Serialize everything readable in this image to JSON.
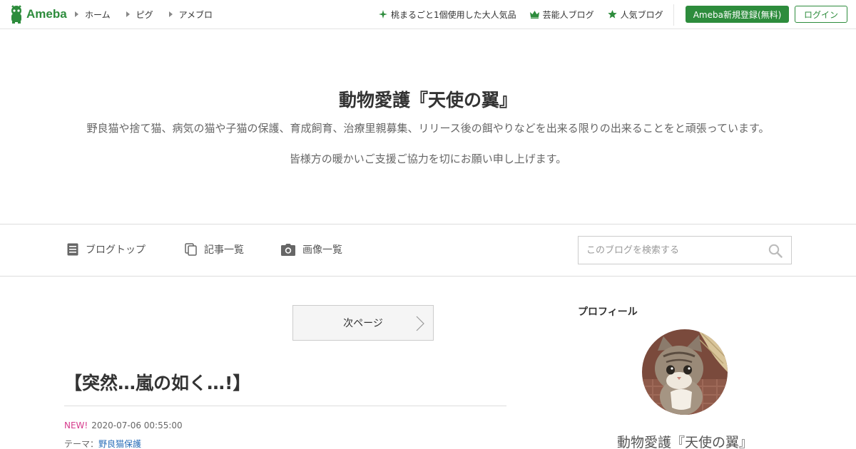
{
  "header": {
    "logo_text": "Ameba",
    "nav_left": [
      "ホーム",
      "ピグ",
      "アメブロ"
    ],
    "nav_right": [
      {
        "label": "桃まるごと1個使用した大人気品",
        "icon": "sparkle-icon"
      },
      {
        "label": "芸能人ブログ",
        "icon": "crown-icon"
      },
      {
        "label": "人気ブログ",
        "icon": "star-icon"
      }
    ],
    "register_label": "Ameba新規登録(無料)",
    "login_label": "ログイン"
  },
  "blog": {
    "title": "動物愛護『天使の翼』",
    "description": "野良猫や捨て猫、病気の猫や子猫の保護、育成飼育、治療里親募集、リリース後の餌やりなどを出来る限りの出来ることをと頑張っています。",
    "description2": "皆様方の暖かいご支援ご協力を切にお願い申し上げます。"
  },
  "subnav": {
    "items": [
      "ブログトップ",
      "記事一覧",
      "画像一覧"
    ],
    "search_placeholder": "このブログを検索する"
  },
  "main": {
    "next_page_label": "次ページ",
    "entry_title": "【突然…嵐の如く…!】",
    "new_badge": "NEW!",
    "timestamp": "2020-07-06 00:55:00",
    "theme_label": "テーマ：",
    "theme_value": "野良猫保護"
  },
  "sidebar": {
    "heading": "プロフィール",
    "profile_name": "動物愛護『天使の翼』"
  },
  "colors": {
    "brand_green": "#2d8c3c",
    "new_badge": "#d63b8c",
    "link": "#2a6eb8"
  }
}
